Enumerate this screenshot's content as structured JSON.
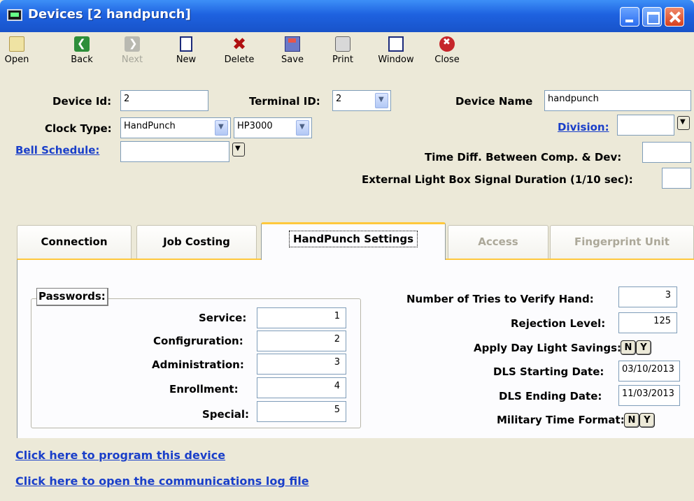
{
  "window": {
    "title": "Devices [2 handpunch]"
  },
  "toolbar": {
    "open": "Open",
    "back": "Back",
    "next": "Next",
    "new": "New",
    "delete": "Delete",
    "save": "Save",
    "print": "Print",
    "window": "Window",
    "close": "Close"
  },
  "form": {
    "device_id_label": "Device Id:",
    "device_id_value": "2",
    "terminal_id_label": "Terminal ID:",
    "terminal_id_value": "2",
    "device_name_label": "Device Name",
    "device_name_value": "handpunch",
    "clock_type_label": "Clock Type:",
    "clock_type_value": "HandPunch",
    "model_value": "HP3000",
    "division_label": "Division:",
    "division_value": "",
    "bell_schedule_label": "Bell Schedule:",
    "bell_schedule_value": "",
    "time_diff_label": "Time Diff. Between Comp. & Dev:",
    "time_diff_value": "",
    "light_box_label": "External Light Box Signal Duration (1/10 sec):",
    "light_box_value": ""
  },
  "tabs": [
    {
      "label": "Connection",
      "state": "normal"
    },
    {
      "label": "Job Costing",
      "state": "normal"
    },
    {
      "label": "HandPunch Settings",
      "state": "active"
    },
    {
      "label": "Access",
      "state": "disabled"
    },
    {
      "label": "Fingerprint Unit",
      "state": "disabled"
    }
  ],
  "passwords": {
    "legend": "Passwords:",
    "rows": [
      {
        "label": "Service:",
        "value": "1"
      },
      {
        "label": "Configruration:",
        "value": "2"
      },
      {
        "label": "Administration:",
        "value": "3"
      },
      {
        "label": "Enrollment:",
        "value": "4"
      },
      {
        "label": "Special:",
        "value": "5"
      }
    ]
  },
  "settings": {
    "tries_label": "Number of Tries to Verify Hand:",
    "tries_value": "3",
    "rejection_label": "Rejection Level:",
    "rejection_value": "125",
    "dls_label": "Apply Day Light Savings:",
    "dls_start_label": "DLS Starting Date:",
    "dls_start_value": "03/10/2013",
    "dls_end_label": "DLS Ending Date:",
    "dls_end_value": "11/03/2013",
    "military_label": "Military Time Format:",
    "no_label": "N",
    "yes_label": "Y"
  },
  "links": {
    "program": "Click here to program this device",
    "comm_log": "Click here to open the communications log file"
  }
}
